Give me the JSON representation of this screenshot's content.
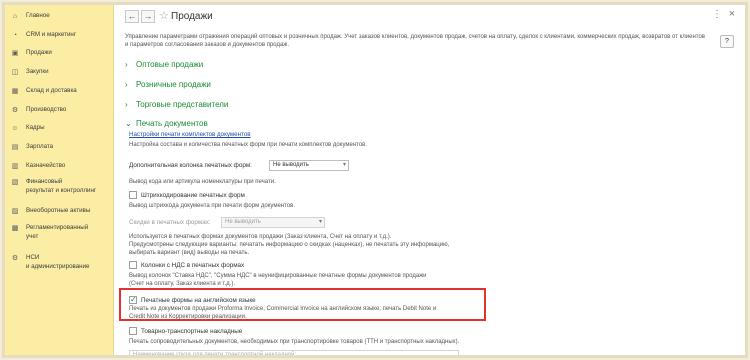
{
  "sidebar": {
    "items": [
      {
        "label": "Главное",
        "icon": "home-icon",
        "glyph": "⌂"
      },
      {
        "label": "CRM и маркетинг",
        "icon": "crm-icon",
        "glyph": "◔"
      },
      {
        "label": "Продажи",
        "icon": "sales-icon",
        "glyph": "▣"
      },
      {
        "label": "Закупки",
        "icon": "cart-icon",
        "glyph": "◫"
      },
      {
        "label": "Склад и доставка",
        "icon": "warehouse-icon",
        "glyph": "▦"
      },
      {
        "label": "Производство",
        "icon": "factory-icon",
        "glyph": "⚙"
      },
      {
        "label": "Кадры",
        "icon": "people-icon",
        "glyph": "☺"
      },
      {
        "label": "Зарплата",
        "icon": "salary-icon",
        "glyph": "▤"
      },
      {
        "label": "Казначейство",
        "icon": "treasury-icon",
        "glyph": "▥"
      },
      {
        "label": "Финансовый\nрезультат и контроллинг",
        "icon": "chart-icon",
        "glyph": "▧"
      },
      {
        "label": "Внеоборотные активы",
        "icon": "assets-icon",
        "glyph": "▨"
      },
      {
        "label": "Регламентированный\nучет",
        "icon": "ledger-icon",
        "glyph": "▩"
      },
      {
        "label": "НСИ\nи администрирование",
        "icon": "settings-icon",
        "glyph": "⚙"
      }
    ]
  },
  "header": {
    "back": "←",
    "forward": "→",
    "star": "☆",
    "title": "Продажи",
    "more": "⋮",
    "close": "×",
    "help": "?"
  },
  "main": {
    "description": "Управление параметрами отражения операций оптовых и розничных продаж. Учет заказов клиентов, документов продаж, счетов на оплату, сделок с клиентами, коммерческих продаж, возвратов от клиентов и параметров согласования заказов и документов продаж.",
    "sections": {
      "wholesale": "Оптовые продажи",
      "retail": "Розничные продажи",
      "agents": "Торговые представители",
      "print": "Печать документов"
    },
    "print": {
      "settings_link": "Настройки печати комплектов документов",
      "settings_hint": "Настройка состава и количества печатных форм при печати комплектов документов.",
      "extra_column_label": "Дополнительная колонка печатных форм:",
      "extra_column_value": "Не выводить",
      "article_hint": "Вывод кода или артикула номенклатуры при печати.",
      "barcode_label": "Штрихкодирование печатных форм",
      "barcode_hint": "Вывод штрихкода документа при печати форм документов.",
      "discounts_label": "Скидки в печатных формах:",
      "discounts_value": "Не выводить",
      "discounts_hint": "Используется в печатных формах документов продажи (Заказ клиента, Счет на оплату и т.д.).\nПредусмотрены следующие варианты: печатать информацию о скидках (наценках), не печатать эту информацию,\nвыбирать вариант (вид) выводы на печать.",
      "vat_label": "Колонки с НДС в печатных формах",
      "vat_hint": "Вывод колонок \"Ставка НДС\", \"Сумма НДС\" в неунифицированные печатные формы документов продажи\n(Счет на оплату, Заказ клиента и т.д.).",
      "english_label": "Печатные формы на английском языке",
      "english_checked_mark": "✓",
      "english_hint": "Печать из документов продажи Proforma Invoice, Commercial Invoice на английском языке, печать Debit Note и\nCredit Note из Корректировки реализации.",
      "waybill_label": "Товарно-транспортные накладные",
      "waybill_hint": "Печать сопроводительных документов, необходимых при транспортировке товаров (ТТН и транспортных накладных).",
      "cargo_placeholder": "Наименование груза для печати транспортной накладной:"
    }
  }
}
